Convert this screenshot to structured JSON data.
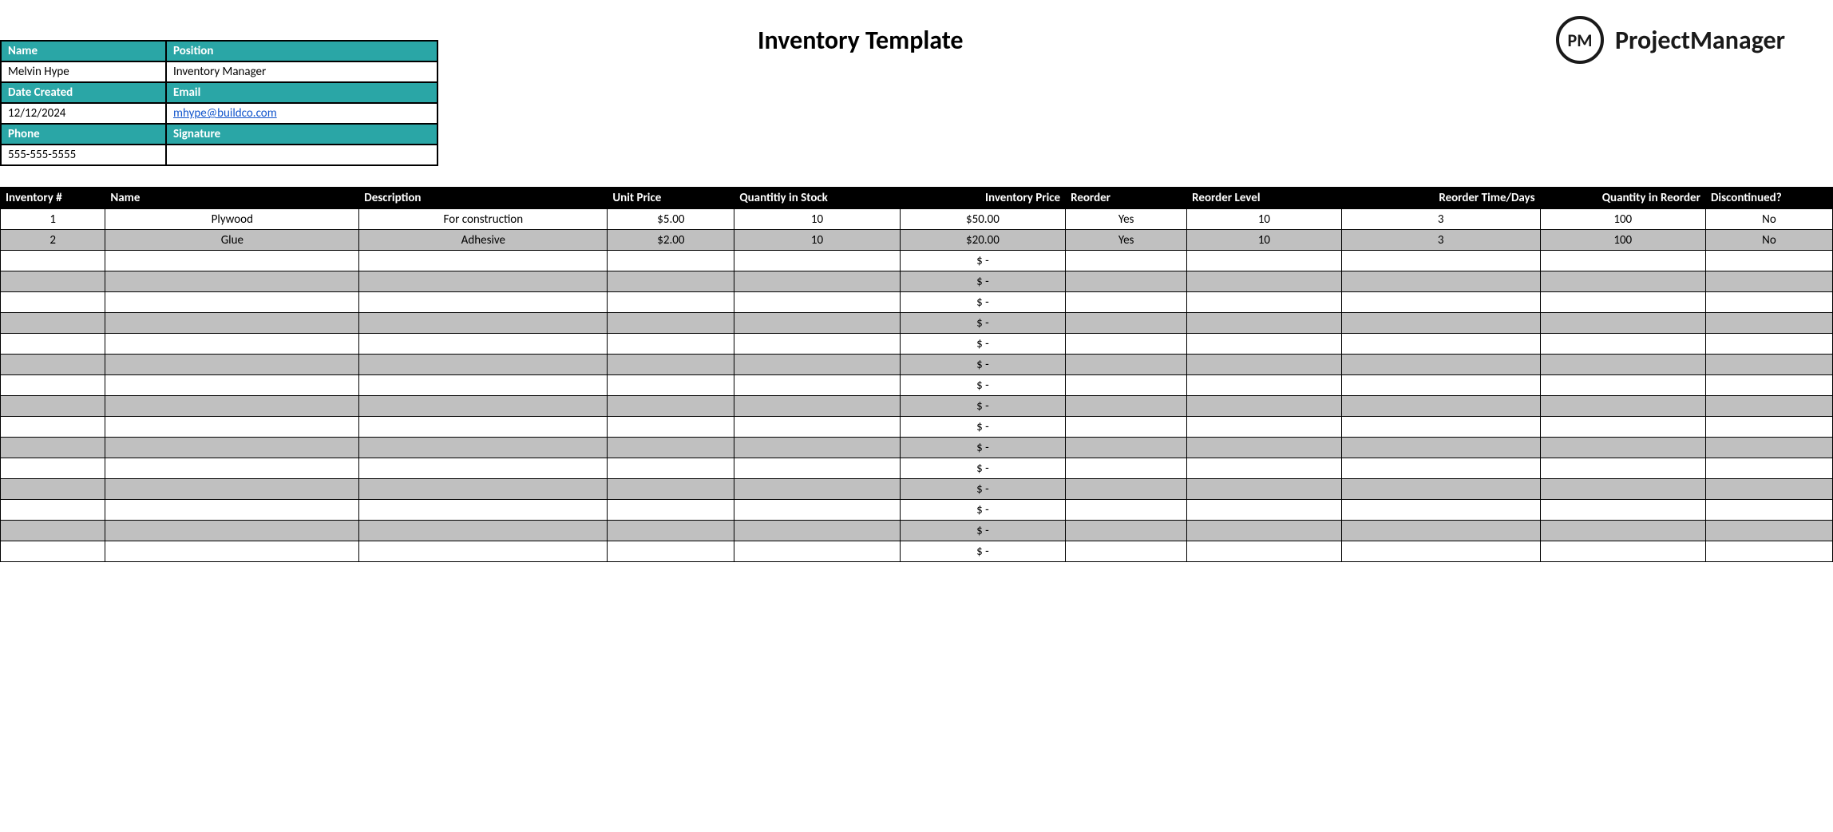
{
  "title": "Inventory Template",
  "logo": {
    "badge": "PM",
    "text": "ProjectManager"
  },
  "info": {
    "name_label": "Name",
    "name_value": "Melvin Hype",
    "position_label": "Position",
    "position_value": "Inventory Manager",
    "date_label": "Date Created",
    "date_value": "12/12/2024",
    "email_label": "Email",
    "email_value": "mhype@buildco.com",
    "phone_label": "Phone",
    "phone_value": "555-555-5555",
    "signature_label": "Signature",
    "signature_value": ""
  },
  "headers": {
    "inv_num": "Inventory #",
    "name": "Name",
    "desc": "Description",
    "unit": "Unit Price",
    "qty": "Quantitiy in Stock",
    "inv_price": "Inventory Price",
    "reorder": "Reorder",
    "level": "Reorder Level",
    "time": "Reorder Time/Days",
    "qre": "Quantity in Reorder",
    "disc": "Discontinued?"
  },
  "rows": [
    {
      "inv_num": "1",
      "name": "Plywood",
      "desc": "For construction",
      "unit": "$5.00",
      "qty": "10",
      "inv_price": "$50.00",
      "reorder": "Yes",
      "level": "10",
      "time": "3",
      "qre": "100",
      "disc": "No"
    },
    {
      "inv_num": "2",
      "name": "Glue",
      "desc": "Adhesive",
      "unit": "$2.00",
      "qty": "10",
      "inv_price": "$20.00",
      "reorder": "Yes",
      "level": "10",
      "time": "3",
      "qre": "100",
      "disc": "No"
    }
  ],
  "empty_price": "$ -",
  "empty_row_count": 15
}
